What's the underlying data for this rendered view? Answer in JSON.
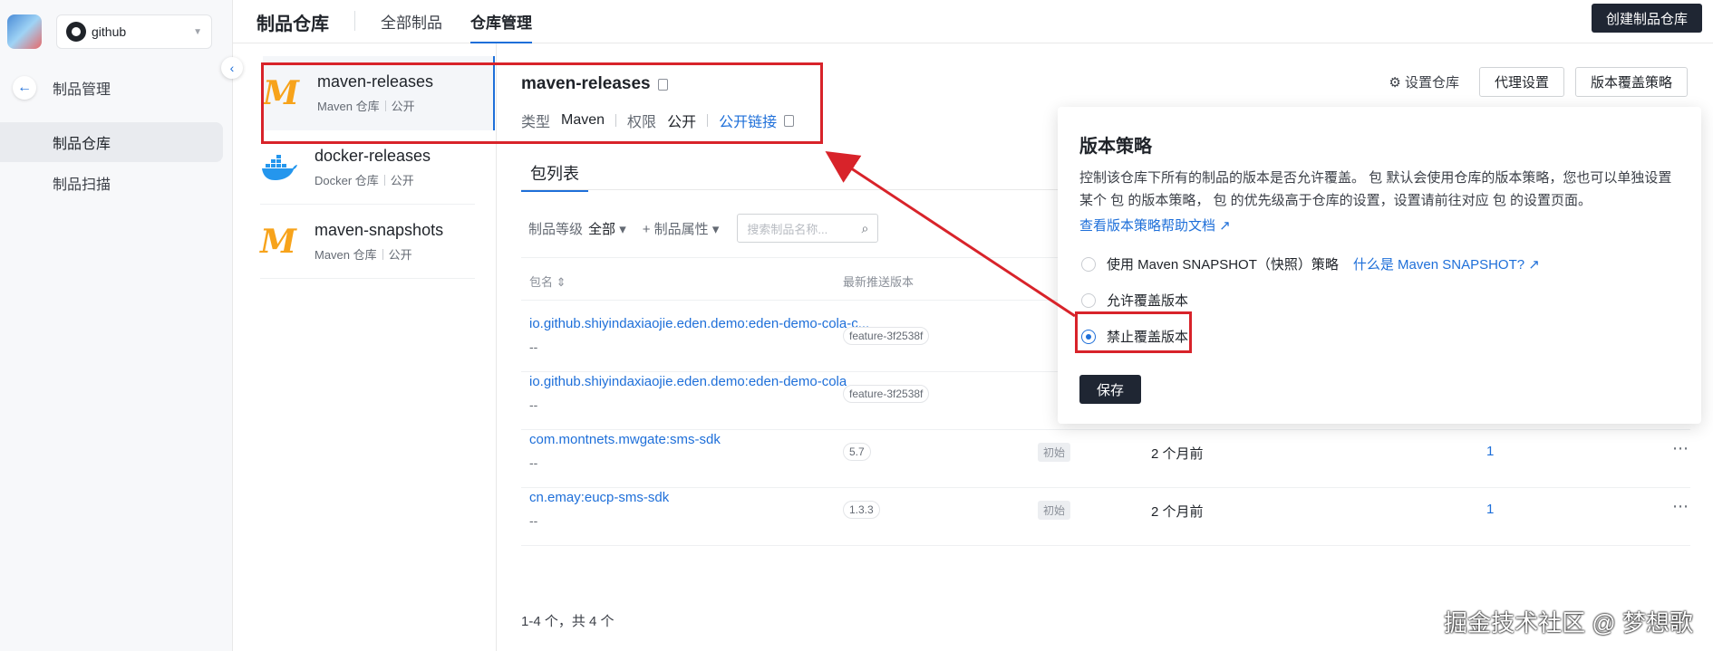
{
  "app": {
    "repo_select": "github"
  },
  "nav": {
    "section": "制品管理",
    "items": [
      {
        "label": "制品仓库",
        "active": true
      },
      {
        "label": "制品扫描",
        "active": false
      }
    ]
  },
  "topbar": {
    "title": "制品仓库",
    "tabs": [
      {
        "label": "全部制品",
        "active": false
      },
      {
        "label": "仓库管理",
        "active": true
      }
    ],
    "create_button": "创建制品仓库"
  },
  "repos": [
    {
      "name": "maven-releases",
      "type": "Maven 仓库",
      "access": "公开",
      "logo": "maven-logo"
    },
    {
      "name": "docker-releases",
      "type": "Docker 仓库",
      "access": "公开",
      "logo": "docker-logo"
    },
    {
      "name": "maven-snapshots",
      "type": "Maven 仓库",
      "access": "公开",
      "logo": "maven-logo"
    }
  ],
  "detail": {
    "title": "maven-releases",
    "type_label": "类型",
    "type_value": "Maven",
    "perm_label": "权限",
    "perm_value": "公开",
    "public_link": "公开链接",
    "settings_link": "设置仓库",
    "proxy_button": "代理设置",
    "overwrite_button": "版本覆盖策略"
  },
  "packages": {
    "tab": "包列表",
    "filter_level_label": "制品等级",
    "filter_level_value": "全部",
    "filter_attr": "+ 制品属性",
    "search_placeholder": "搜索制品名称...",
    "col_name": "包名 ⇕",
    "col_version": "最新推送版本",
    "rows": [
      {
        "name": "io.github.shiyindaxiaojie.eden.demo:eden-demo-cola-c...",
        "desc": "--",
        "version": "feature-3f2538f",
        "tag": "",
        "time": "",
        "count": ""
      },
      {
        "name": "io.github.shiyindaxiaojie.eden.demo:eden-demo-cola",
        "desc": "--",
        "version": "feature-3f2538f",
        "tag": "",
        "time": "",
        "count": ""
      },
      {
        "name": "com.montnets.mwgate:sms-sdk",
        "desc": "--",
        "version": "5.7",
        "tag": "初始",
        "time": "2 个月前",
        "count": "1"
      },
      {
        "name": "cn.emay:eucp-sms-sdk",
        "desc": "--",
        "version": "1.3.3",
        "tag": "初始",
        "time": "2 个月前",
        "count": "1"
      }
    ],
    "total": "1-4 个，共 4 个"
  },
  "popover": {
    "title": "版本策略",
    "desc": "控制该仓库下所有的制品的版本是否允许覆盖。 包 默认会使用仓库的版本策略，您也可以单独设置某个 包 的版本策略， 包 的优先级高于仓库的设置，设置请前往对应 包 的设置页面。",
    "help_link": "查看版本策略帮助文档",
    "options": [
      {
        "label": "使用 Maven SNAPSHOT（快照）策略",
        "link": "什么是 Maven SNAPSHOT?",
        "selected": false
      },
      {
        "label": "允许覆盖版本",
        "link": "",
        "selected": false
      },
      {
        "label": "禁止覆盖版本",
        "link": "",
        "selected": true
      }
    ],
    "save_button": "保存"
  },
  "watermark": "掘金技术社区 @ 梦想歌",
  "colors": {
    "accent": "#1e6fd9",
    "dark_button": "#1f2633",
    "annotation_red": "#d8232a"
  }
}
